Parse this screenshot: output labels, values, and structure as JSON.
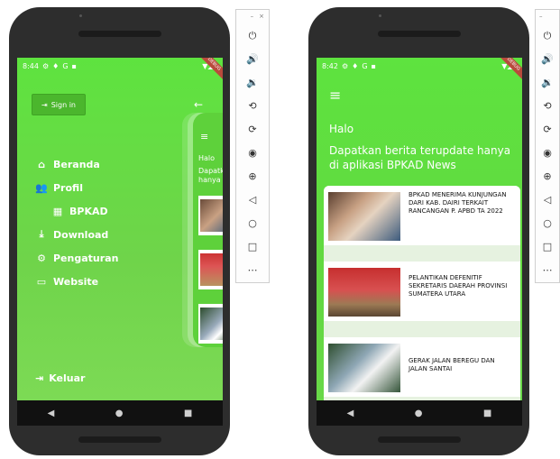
{
  "left_phone": {
    "status": {
      "time": "8:44",
      "icons": [
        "⚙",
        "♦",
        "G",
        "▪"
      ],
      "signal": "▼◢▮"
    },
    "debug_label": "DEBUG",
    "signin_label": "Sign in",
    "back_icon": "←",
    "menu": [
      {
        "icon": "home-icon",
        "glyph": "⌂",
        "label": "Beranda"
      },
      {
        "icon": "people-icon",
        "glyph": "👥",
        "label": "Profil"
      },
      {
        "icon": "building-icon",
        "glyph": "▦",
        "label": "BPKAD",
        "sub": true
      },
      {
        "icon": "download-icon",
        "glyph": "⤓",
        "label": "Download"
      },
      {
        "icon": "gear-icon",
        "glyph": "⚙",
        "label": "Pengaturan"
      },
      {
        "icon": "web-icon",
        "glyph": "▭",
        "label": "Website"
      }
    ],
    "logout_label": "Keluar",
    "peek": {
      "halo": "Halo",
      "line1": "Dapatka",
      "line2": "hanya di"
    }
  },
  "right_phone": {
    "status": {
      "time": "8:42",
      "icons": [
        "⚙",
        "♦",
        "G",
        "▪"
      ],
      "signal": "▼◢▮"
    },
    "debug_label": "DEBUG",
    "halo": "Halo",
    "headline": "Dapatkan berita terupdate hanya di aplikasi BPKAD News",
    "news": [
      {
        "title": "BPKAD MENERIMA KUNJUNGAN DARI KAB. DAIRI TERKAIT RANCANGAN P. APBD TA 2022"
      },
      {
        "title": "PELANTIKAN DEFENITIF SEKRETARIS DAERAH PROVINSI SUMATERA UTARA"
      },
      {
        "title": "GERAK JALAN BEREGU DAN JALAN SANTAI"
      }
    ]
  },
  "navbar": {
    "back": "◀",
    "home": "●",
    "recents": "■"
  },
  "toolbar": {
    "window_buttons": [
      "–",
      "×"
    ],
    "buttons": [
      {
        "icon": "power-icon",
        "glyph": "⏻"
      },
      {
        "icon": "volume-up-icon",
        "glyph": "🔊"
      },
      {
        "icon": "volume-down-icon",
        "glyph": "🔉"
      },
      {
        "icon": "rotate-left-icon",
        "glyph": "⟲"
      },
      {
        "icon": "rotate-right-icon",
        "glyph": "⟳"
      },
      {
        "icon": "camera-icon",
        "glyph": "◉"
      },
      {
        "icon": "zoom-icon",
        "glyph": "⊕"
      },
      {
        "icon": "back-icon",
        "glyph": "◁"
      },
      {
        "icon": "home-icon",
        "glyph": "○"
      },
      {
        "icon": "overview-icon",
        "glyph": "□"
      },
      {
        "icon": "more-icon",
        "glyph": "⋯"
      }
    ]
  }
}
